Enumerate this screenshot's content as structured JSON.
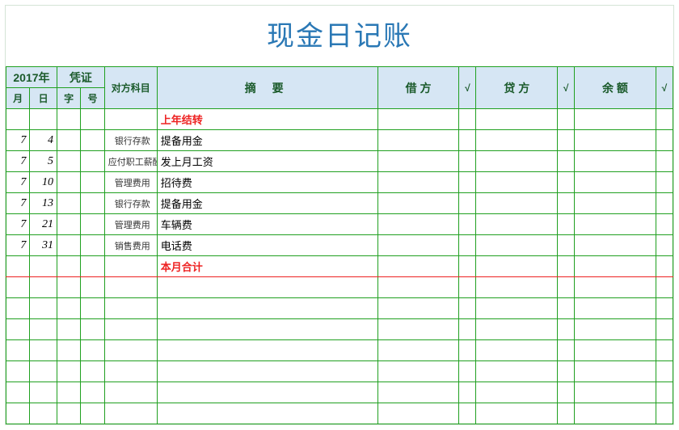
{
  "title": "现金日记账",
  "header": {
    "year": "2017年",
    "voucher": "凭证",
    "month": "月",
    "day": "日",
    "word": "字",
    "number": "号",
    "subject": "对方科目",
    "summary": "摘    要",
    "debit": "借 方",
    "check1": "√",
    "credit": "贷  方",
    "check2": "√",
    "balance": "余  额",
    "check3": "√"
  },
  "rows": [
    {
      "month": "",
      "day": "",
      "word": "",
      "num": "",
      "subj": "",
      "summary": "上年结转",
      "summary_red": true,
      "debit": "",
      "c1": "",
      "credit": "",
      "c2": "",
      "bal": "",
      "c3": ""
    },
    {
      "month": "7",
      "day": "4",
      "word": "",
      "num": "",
      "subj": "银行存款",
      "summary": "提备用金",
      "debit": "",
      "c1": "",
      "credit": "",
      "c2": "",
      "bal": "",
      "c3": ""
    },
    {
      "month": "7",
      "day": "5",
      "word": "",
      "num": "",
      "subj": "应付职工薪酬",
      "summary": "发上月工资",
      "debit": "",
      "c1": "",
      "credit": "",
      "c2": "",
      "bal": "",
      "c3": ""
    },
    {
      "month": "7",
      "day": "10",
      "word": "",
      "num": "",
      "subj": "管理费用",
      "summary": "招待费",
      "debit": "",
      "c1": "",
      "credit": "",
      "c2": "",
      "bal": "",
      "c3": ""
    },
    {
      "month": "7",
      "day": "13",
      "word": "",
      "num": "",
      "subj": "银行存款",
      "summary": "提备用金",
      "debit": "",
      "c1": "",
      "credit": "",
      "c2": "",
      "bal": "",
      "c3": ""
    },
    {
      "month": "7",
      "day": "21",
      "word": "",
      "num": "",
      "subj": "管理费用",
      "summary": "车辆费",
      "debit": "",
      "c1": "",
      "credit": "",
      "c2": "",
      "bal": "",
      "c3": ""
    },
    {
      "month": "7",
      "day": "31",
      "word": "",
      "num": "",
      "subj": "销售费用",
      "summary": "电话费",
      "debit": "",
      "c1": "",
      "credit": "",
      "c2": "",
      "bal": "",
      "c3": ""
    },
    {
      "month": "",
      "day": "",
      "word": "",
      "num": "",
      "subj": "",
      "summary": "本月合计",
      "summary_red": true,
      "total": true,
      "debit": "",
      "c1": "",
      "credit": "",
      "c2": "",
      "bal": "",
      "c3": ""
    },
    {
      "month": "",
      "day": "",
      "word": "",
      "num": "",
      "subj": "",
      "summary": "",
      "debit": "",
      "c1": "",
      "credit": "",
      "c2": "",
      "bal": "",
      "c3": ""
    },
    {
      "month": "",
      "day": "",
      "word": "",
      "num": "",
      "subj": "",
      "summary": "",
      "debit": "",
      "c1": "",
      "credit": "",
      "c2": "",
      "bal": "",
      "c3": ""
    },
    {
      "month": "",
      "day": "",
      "word": "",
      "num": "",
      "subj": "",
      "summary": "",
      "debit": "",
      "c1": "",
      "credit": "",
      "c2": "",
      "bal": "",
      "c3": ""
    },
    {
      "month": "",
      "day": "",
      "word": "",
      "num": "",
      "subj": "",
      "summary": "",
      "debit": "",
      "c1": "",
      "credit": "",
      "c2": "",
      "bal": "",
      "c3": ""
    },
    {
      "month": "",
      "day": "",
      "word": "",
      "num": "",
      "subj": "",
      "summary": "",
      "debit": "",
      "c1": "",
      "credit": "",
      "c2": "",
      "bal": "",
      "c3": ""
    },
    {
      "month": "",
      "day": "",
      "word": "",
      "num": "",
      "subj": "",
      "summary": "",
      "debit": "",
      "c1": "",
      "credit": "",
      "c2": "",
      "bal": "",
      "c3": ""
    },
    {
      "month": "",
      "day": "",
      "word": "",
      "num": "",
      "subj": "",
      "summary": "",
      "debit": "",
      "c1": "",
      "credit": "",
      "c2": "",
      "bal": "",
      "c3": ""
    }
  ]
}
